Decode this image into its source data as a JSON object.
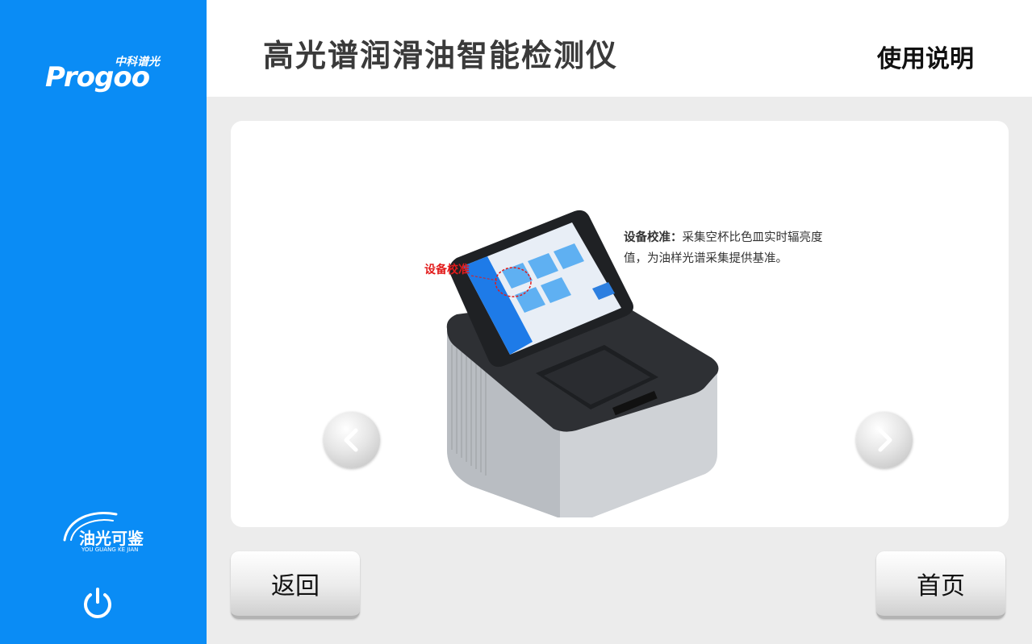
{
  "sidebar": {
    "logo_cn": "中科谱光",
    "logo_en": "Progoo",
    "brand_cn": "油光可鉴",
    "brand_en": "YOU GUANG KE JIAN",
    "power_icon": "power-icon"
  },
  "header": {
    "app_title": "高光谱润滑油智能检测仪",
    "page_title": "使用说明"
  },
  "slide": {
    "callout": "设备校准",
    "desc_title": "设备校准：",
    "desc_text": "采集空杯比色皿实时辐亮度值，为油样光谱采集提供基准。",
    "prev_icon": "chevron-left-icon",
    "next_icon": "chevron-right-icon"
  },
  "buttons": {
    "back": "返回",
    "home": "首页"
  },
  "colors": {
    "sidebar": "#0a8cf5",
    "background": "#ececec",
    "callout": "#e21b1b"
  }
}
